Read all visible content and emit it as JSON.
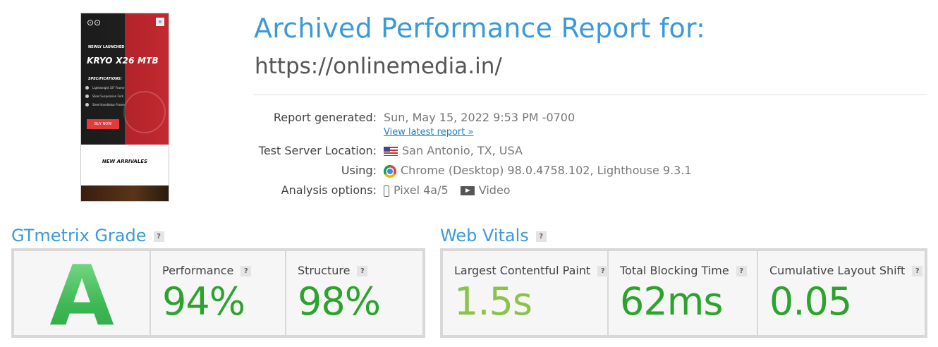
{
  "thumbnail": {
    "menu_glyph": "≡",
    "badge": "NEWLY LAUNCHED",
    "model": "KRYO X26 MTB",
    "specs_heading": "SPECIFICATIONS:",
    "spec_items": [
      "Lightweight 18\" Frame",
      "Steel Suspension Fork",
      "Steel Handlebar Frame"
    ],
    "buy_label": "BUY NOW",
    "arrivals": "NEW ARRIVALES"
  },
  "header": {
    "title": "Archived Performance Report for:",
    "url": "https://onlinemedia.in/"
  },
  "info": {
    "report_generated_label": "Report generated:",
    "report_generated_value": "Sun, May 15, 2022 9:53 PM -0700",
    "latest_link": "View latest report »",
    "location_label": "Test Server Location:",
    "location_value": "San Antonio, TX, USA",
    "using_label": "Using:",
    "using_value": "Chrome (Desktop) 98.0.4758.102, Lighthouse 9.3.1",
    "analysis_label": "Analysis options:",
    "device": "Pixel 4a/5",
    "video": "Video"
  },
  "grade": {
    "title": "GTmetrix Grade",
    "help": "?",
    "letter": "A",
    "performance_label": "Performance",
    "performance_value": "94%",
    "structure_label": "Structure",
    "structure_value": "98%"
  },
  "vitals": {
    "title": "Web Vitals",
    "help": "?",
    "lcp_label": "Largest Contentful Paint",
    "lcp_value": "1.5s",
    "tbt_label": "Total Blocking Time",
    "tbt_value": "62ms",
    "cls_label": "Cumulative Layout Shift",
    "cls_value": "0.05"
  },
  "colors": {
    "accent": "#3a9ad9",
    "good_green": "#2ca32c",
    "lcp_green": "#8bc34a",
    "link": "#1e7fce"
  }
}
